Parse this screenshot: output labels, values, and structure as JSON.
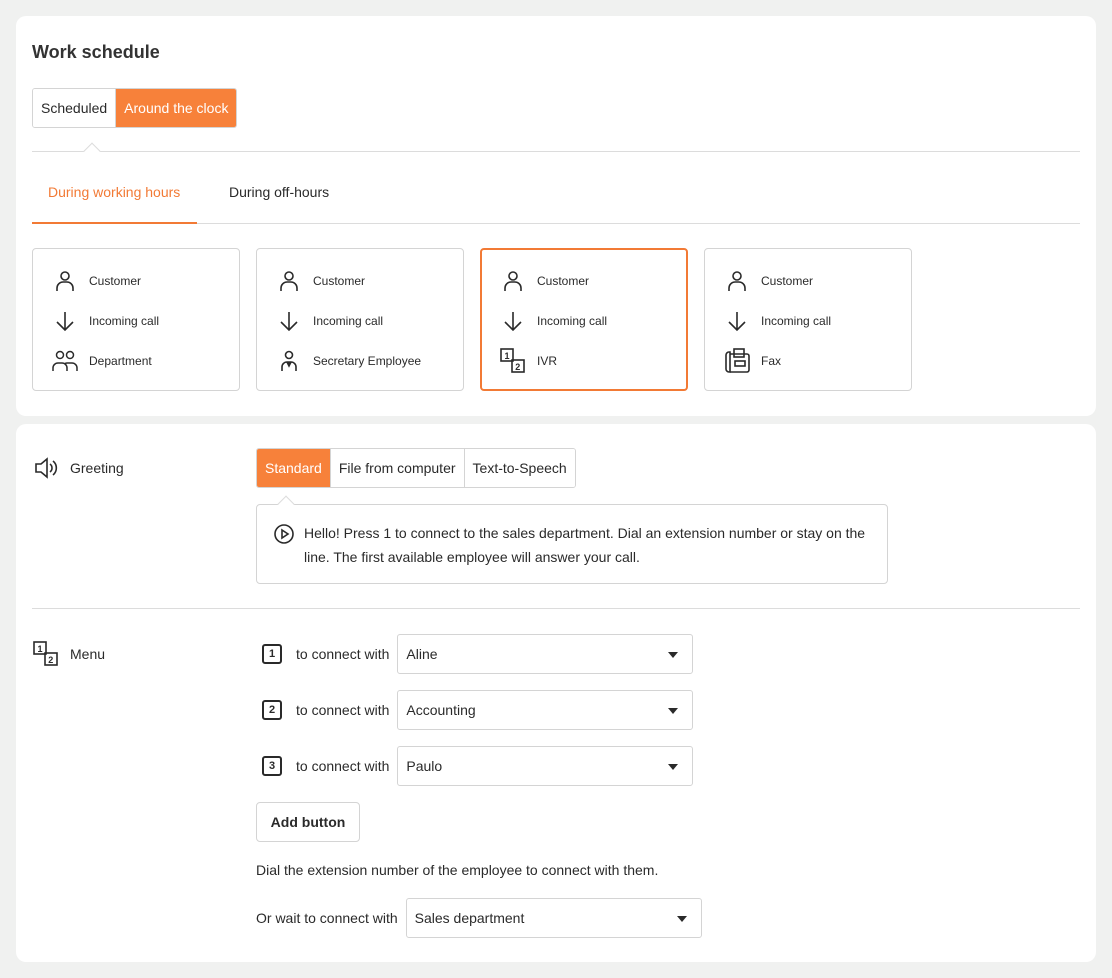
{
  "schedule": {
    "title": "Work schedule",
    "modes": [
      {
        "label": "Scheduled",
        "active": false
      },
      {
        "label": "Around the clock",
        "active": true
      }
    ]
  },
  "hours_tabs": [
    {
      "label": "During working hours",
      "active": true
    },
    {
      "label": "During off-hours",
      "active": false
    }
  ],
  "routes": [
    {
      "rows": [
        {
          "icon": "person-icon",
          "label": "Customer"
        },
        {
          "icon": "arrow-down-icon",
          "label": "Incoming call"
        },
        {
          "icon": "group-icon",
          "label": "Department"
        }
      ],
      "selected": false
    },
    {
      "rows": [
        {
          "icon": "person-icon",
          "label": "Customer"
        },
        {
          "icon": "arrow-down-icon",
          "label": "Incoming call"
        },
        {
          "icon": "secretary-icon",
          "label": "Secretary Employee"
        }
      ],
      "selected": false
    },
    {
      "rows": [
        {
          "icon": "person-icon",
          "label": "Customer"
        },
        {
          "icon": "arrow-down-icon",
          "label": "Incoming call"
        },
        {
          "icon": "ivr-icon",
          "label": "IVR"
        }
      ],
      "selected": true
    },
    {
      "rows": [
        {
          "icon": "person-icon",
          "label": "Customer"
        },
        {
          "icon": "arrow-down-icon",
          "label": "Incoming call"
        },
        {
          "icon": "fax-icon",
          "label": "Fax"
        }
      ],
      "selected": false
    }
  ],
  "greeting": {
    "label": "Greeting",
    "sources": [
      {
        "label": "Standard",
        "active": true
      },
      {
        "label": "File from computer",
        "active": false
      },
      {
        "label": "Text-to-Speech",
        "active": false
      }
    ],
    "message": "Hello! Press 1 to connect to the sales department. Dial an extension number or stay on the line. The first available employee will answer your call."
  },
  "menu": {
    "label": "Menu",
    "items": [
      {
        "key": "1",
        "text": "to connect with",
        "target": "Aline"
      },
      {
        "key": "2",
        "text": "to connect with",
        "target": "Accounting"
      },
      {
        "key": "3",
        "text": "to connect with",
        "target": "Paulo"
      }
    ],
    "add_button": "Add button",
    "hint": "Dial the extension number of the employee to connect with them.",
    "wait_label": "Or wait to connect with",
    "wait_target": "Sales department"
  },
  "colors": {
    "accent": "#f7813a",
    "border": "#d4d4d4",
    "background": "#f0f1f0"
  }
}
